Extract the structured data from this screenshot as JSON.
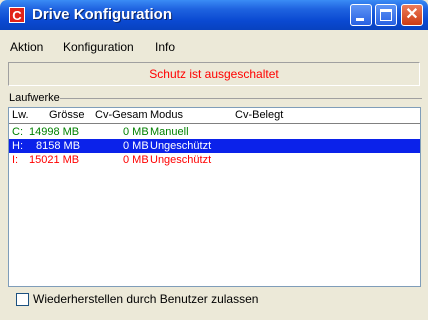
{
  "window": {
    "title": "Drive Konfiguration",
    "icon_letter": "C"
  },
  "menu": [
    "Aktion",
    "Konfiguration",
    "Info"
  ],
  "status": {
    "text": "Schutz ist ausgeschaltet",
    "color": "#ff0000"
  },
  "group": {
    "label": "Laufwerke"
  },
  "table": {
    "columns": [
      "Lw.",
      "Grösse",
      "Cv-Gesam",
      "Modus",
      "Cv-Belegt"
    ],
    "rows": [
      {
        "drive": "C:",
        "size": "14998 MB",
        "cv_total": "0 MB",
        "mode": "Manuell",
        "cv_used": "",
        "color": "#008000",
        "selected": false
      },
      {
        "drive": "H:",
        "size": "8158 MB",
        "cv_total": "0 MB",
        "mode": "Ungeschützt",
        "cv_used": "",
        "color": "#ffffff",
        "selected": true
      },
      {
        "drive": "I:",
        "size": "15021 MB",
        "cv_total": "0 MB",
        "mode": "Ungeschützt",
        "cv_used": "",
        "color": "#ff0000",
        "selected": false
      }
    ]
  },
  "checkbox": {
    "label": "Wiederherstellen durch Benutzer zulassen",
    "checked": false
  },
  "icons": [
    "app-icon",
    "minimize-icon",
    "maximize-icon",
    "close-icon"
  ],
  "colors": {
    "titlebar": "#0a49d1",
    "selection": "#0b22ea"
  }
}
